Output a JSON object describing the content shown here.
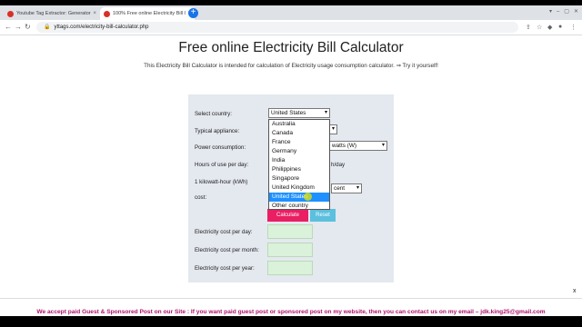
{
  "browser": {
    "tabs": [
      {
        "title": "Youtube Tag Extractor: Generator",
        "active": false
      },
      {
        "title": "100% Free online Electricity Bill C",
        "active": true
      }
    ],
    "url": "yttags.com/electricity-bill-calculator.php"
  },
  "page": {
    "title": "Free online Electricity Bill Calculator",
    "intro": "This Electricity Bill Calculator is intended for calculation of Electricity usage consumption calculator. ⇒ Try it yourself!"
  },
  "form": {
    "country_label": "Select country:",
    "country_value": "United States",
    "appliance_label": "Typical appliance:",
    "power_label": "Power consumption:",
    "power_unit": "watts (W)",
    "hours_label": "Hours of use per day:",
    "hours_suffix": "h/day",
    "kwh_label": "1 kilowatt-hour (kWh)",
    "cost_label": "cost:",
    "cost_unit": "cent",
    "calculate": "Calculate",
    "reset": "Reset",
    "per_day": "Electricity cost per day:",
    "per_month": "Electricity cost per month:",
    "per_year": "Electricity cost per year:"
  },
  "dropdown": {
    "options": [
      "Australia",
      "Canada",
      "France",
      "Germany",
      "India",
      "Philippines",
      "Singapore",
      "United Kingdom",
      "United States",
      "Other country"
    ],
    "highlighted": "United States"
  },
  "promo": {
    "text": "We accept paid Guest & Sponsored Post on our Site : If you want paid guest post or sponsored post on my website, then you can contact us on my email – jdk.king25@gmail.com",
    "close": "x"
  },
  "colors": {
    "calculate_button": "#e91e63",
    "reset_button": "#5bc0de",
    "promo_text": "#b0126b",
    "highlight": "#1e90ff"
  }
}
